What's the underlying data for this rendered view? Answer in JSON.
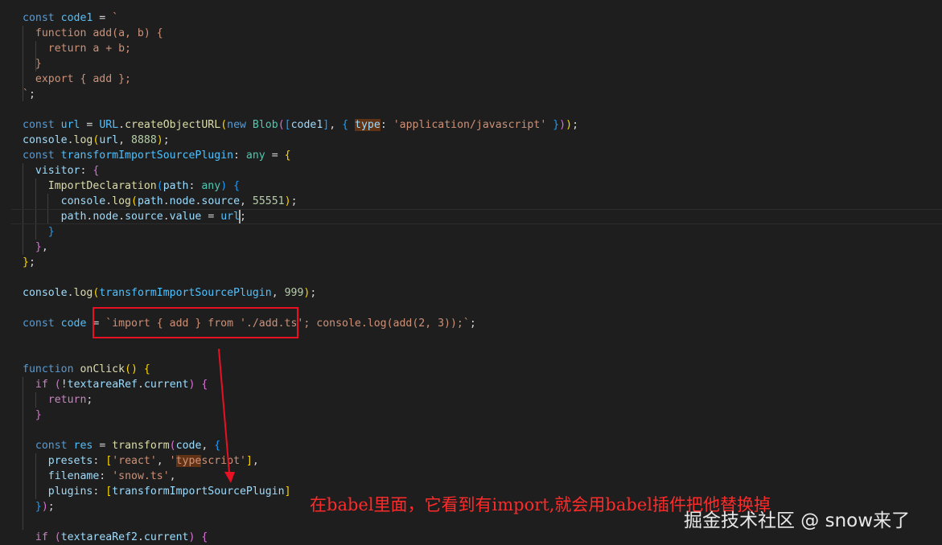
{
  "editor": {
    "lines": [
      "const code1 = `",
      "  function add(a, b) {",
      "    return a + b;",
      "  }",
      "  export { add };",
      "`;",
      "",
      "const url = URL.createObjectURL(new Blob([code1], { type: 'application/javascript' }));",
      "console.log(url, 8888);",
      "const transformImportSourcePlugin: any = {",
      "  visitor: {",
      "    ImportDeclaration(path: any) {",
      "      console.log(path.node.source, 55551);",
      "      path.node.source.value = url;",
      "    }",
      "  },",
      "};",
      "",
      "console.log(transformImportSourcePlugin, 999);",
      "",
      "const code = `import { add } from './add.ts'; console.log(add(2, 3));`;",
      "",
      "",
      "function onClick() {",
      "  if (!textareaRef.current) {",
      "    return;",
      "  }",
      "",
      "  const res = transform(code, {",
      "    presets: ['react', 'typescript'],",
      "    filename: 'snow.ts',",
      "    plugins: [transformImportSourcePlugin]",
      "  });",
      "",
      "  if (textareaRef2.current) {"
    ]
  },
  "annotation": {
    "text": "在babel里面，它看到有import,就会用babel插件把他替换掉"
  },
  "watermark": {
    "text": "掘金技术社区 @ snow来了"
  },
  "colors": {
    "background": "#1e1e1e",
    "annotation": "#ff2a2a",
    "box": "#e81123"
  }
}
